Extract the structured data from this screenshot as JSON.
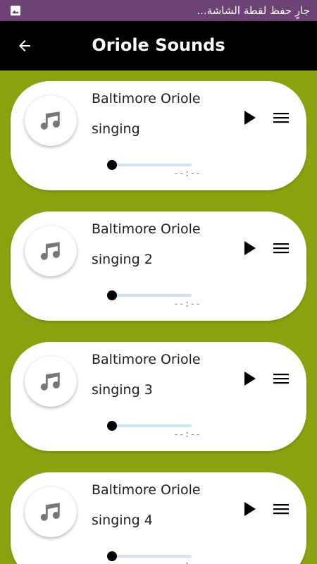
{
  "status_bar": {
    "text": "جارٍ حفظ لقطة الشاشة...",
    "icon": "image-icon",
    "color": "#6d4376"
  },
  "app_bar": {
    "title": "Oriole Sounds",
    "back_icon": "arrow-left-icon",
    "color": "#000000"
  },
  "colors": {
    "background": "#8ba30f",
    "card": "#ffffff",
    "seek_track": "#cfe4f2"
  },
  "sounds": [
    {
      "line1": "Baltimore Oriole",
      "line2": "singing",
      "time": "--:--",
      "progress": 0
    },
    {
      "line1": "Baltimore Oriole",
      "line2": "singing 2",
      "time": "--:--",
      "progress": 0
    },
    {
      "line1": "Baltimore Oriole",
      "line2": "singing 3",
      "time": "--:--",
      "progress": 0
    },
    {
      "line1": "Baltimore Oriole",
      "line2": "singing 4",
      "time": "--:--",
      "progress": 0
    }
  ]
}
